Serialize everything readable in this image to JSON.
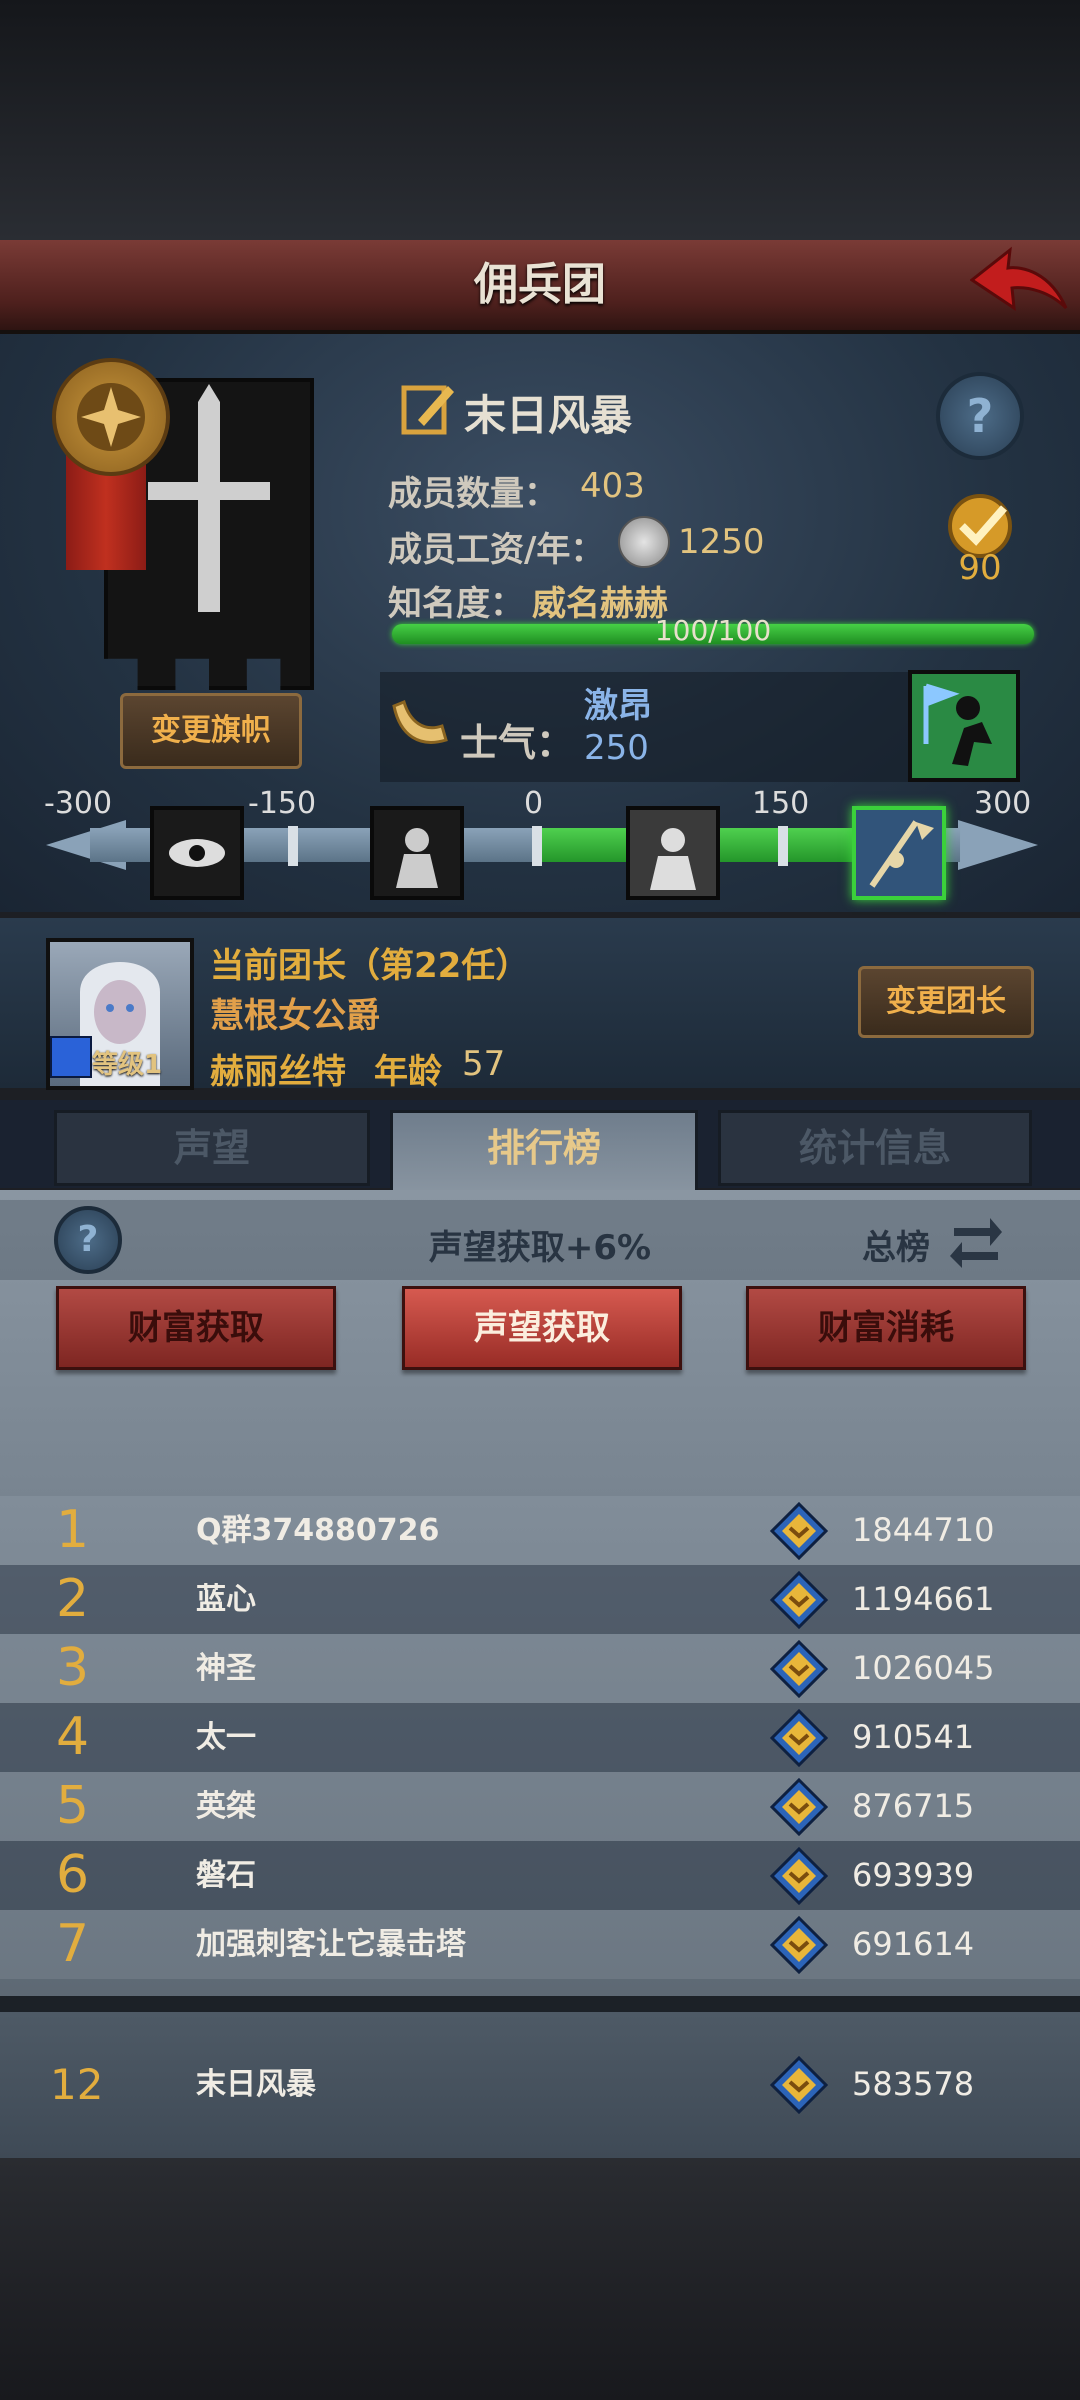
{
  "header": {
    "title": "佣兵团"
  },
  "guild": {
    "name": "末日风暴",
    "members_label": "成员数量：",
    "members_value": "403",
    "salary_label": "成员工资/年：",
    "salary_value": "1250",
    "fame_label": "知名度：",
    "fame_value": "威名赫赫",
    "fame_progress_text": "100/100",
    "fame_progress": 1.0,
    "level_badge": "90",
    "change_flag_label": "变更旗帜"
  },
  "morale": {
    "label": "士气：",
    "state": "激昂",
    "value": "250",
    "scale_ticks": [
      "-300",
      "-150",
      "0",
      "150",
      "300"
    ]
  },
  "leader": {
    "title_line": "当前团长（第22任）",
    "rank_title": "慧根女公爵",
    "name": "赫丽丝特",
    "age_label": "年龄",
    "age_value": "57",
    "level_label": "等级1",
    "change_leader_label": "变更团长"
  },
  "tabs": [
    {
      "label": "声望"
    },
    {
      "label": "排行榜"
    },
    {
      "label": "统计信息"
    }
  ],
  "ranking": {
    "bonus_text": "声望获取+6%",
    "scope_label": "总榜",
    "filters": [
      {
        "label": "财富获取"
      },
      {
        "label": "声望获取"
      },
      {
        "label": "财富消耗"
      }
    ],
    "rows": [
      {
        "rank": "1",
        "name": "Q群374880726",
        "score": "1844710"
      },
      {
        "rank": "2",
        "name": "蓝心",
        "score": "1194661"
      },
      {
        "rank": "3",
        "name": "神圣",
        "score": "1026045"
      },
      {
        "rank": "4",
        "name": "太一",
        "score": "910541"
      },
      {
        "rank": "5",
        "name": "英桀",
        "score": "876715"
      },
      {
        "rank": "6",
        "name": "磐石",
        "score": "693939"
      },
      {
        "rank": "7",
        "name": "加强刺客让它暴击塔",
        "score": "691614"
      }
    ],
    "self": {
      "rank": "12",
      "name": "末日风暴",
      "score": "583578"
    }
  },
  "colors": {
    "accent_gold": "#e2ad3e",
    "morale_green": "#3bd13b",
    "title_red": "#7a3b36"
  }
}
